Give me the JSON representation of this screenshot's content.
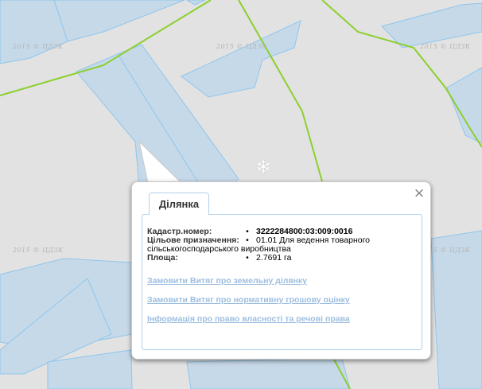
{
  "map": {
    "watermark": "2015 © ЦДЗК",
    "marker_glyph": "❄",
    "colors": {
      "background": "#e2e2e2",
      "parcel_fill": "#c6d9e9",
      "parcel_stroke": "#8fc6ec",
      "boundary_line": "#8ccf2e"
    }
  },
  "popup": {
    "close_glyph": "×",
    "tab_label": "Ділянка",
    "fields": {
      "cadastral_label": "Кадастр.номер:",
      "cadastral_value": "3222284800:03:009:0016",
      "purpose_label": "Цільове призначення:",
      "purpose_value_line1": "01.01 Для ведення товарного",
      "purpose_value_line2": "сільськогосподарського виробництва",
      "area_label": "Площа:",
      "area_value": "2.7691 га",
      "bullet": "•"
    },
    "links": {
      "order_extract": "Замовити Витяг про земельну ділянку",
      "order_valuation": "Замовити Витяг про нормативну грошову оцінку",
      "ownership_info": "Інформація про право власності та речові права"
    }
  }
}
